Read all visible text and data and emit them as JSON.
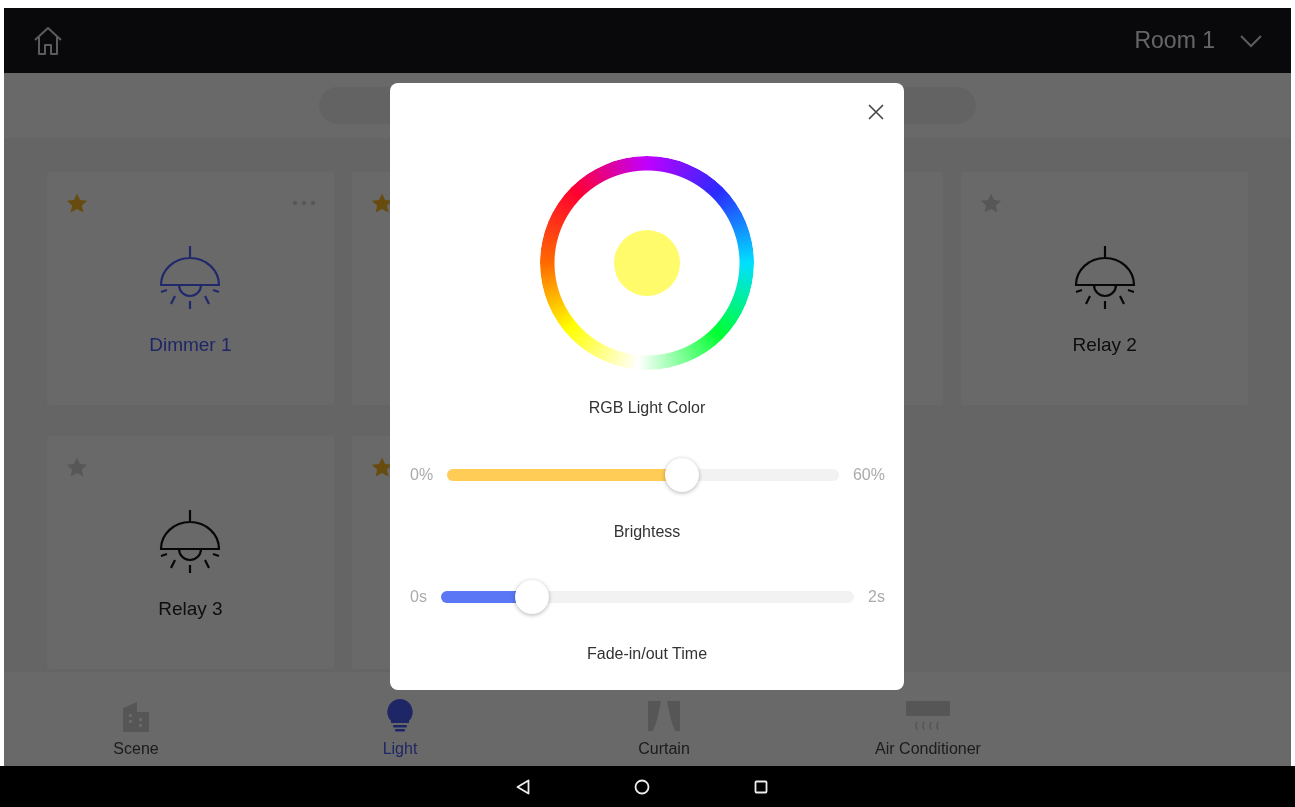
{
  "top_bar": {
    "room": "Room 1"
  },
  "cards": [
    {
      "kind": "light",
      "name": "Dimmer 1",
      "starred": true,
      "on": true,
      "more_button": true
    },
    {
      "kind": "light",
      "starred": true
    },
    {
      "kind": "light"
    },
    {
      "kind": "light",
      "name": "Relay 2",
      "starred": false,
      "on": false,
      "more_button": false
    },
    {
      "kind": "light",
      "name": "Relay 3",
      "starred": false,
      "on": false,
      "more_button": false
    },
    {
      "kind": "light",
      "starred": true
    }
  ],
  "dialog": {
    "color_label": "RGB Light Color",
    "sliders": [
      {
        "kind": "brightness",
        "min": "0%",
        "max": "60%",
        "level": 0.6,
        "label": "Brightess"
      },
      {
        "kind": "fade",
        "min": "0s",
        "max": "2s",
        "level": 0.22,
        "label": "Fade-in/out Time"
      }
    ]
  },
  "tabs": [
    {
      "kind": "scene",
      "label": "Scene",
      "selected": false
    },
    {
      "kind": "light",
      "label": "Light",
      "selected": true
    },
    {
      "kind": "curtain",
      "label": "Curtain",
      "selected": false
    },
    {
      "kind": "ac",
      "label": "Air Conditioner",
      "selected": false
    }
  ]
}
